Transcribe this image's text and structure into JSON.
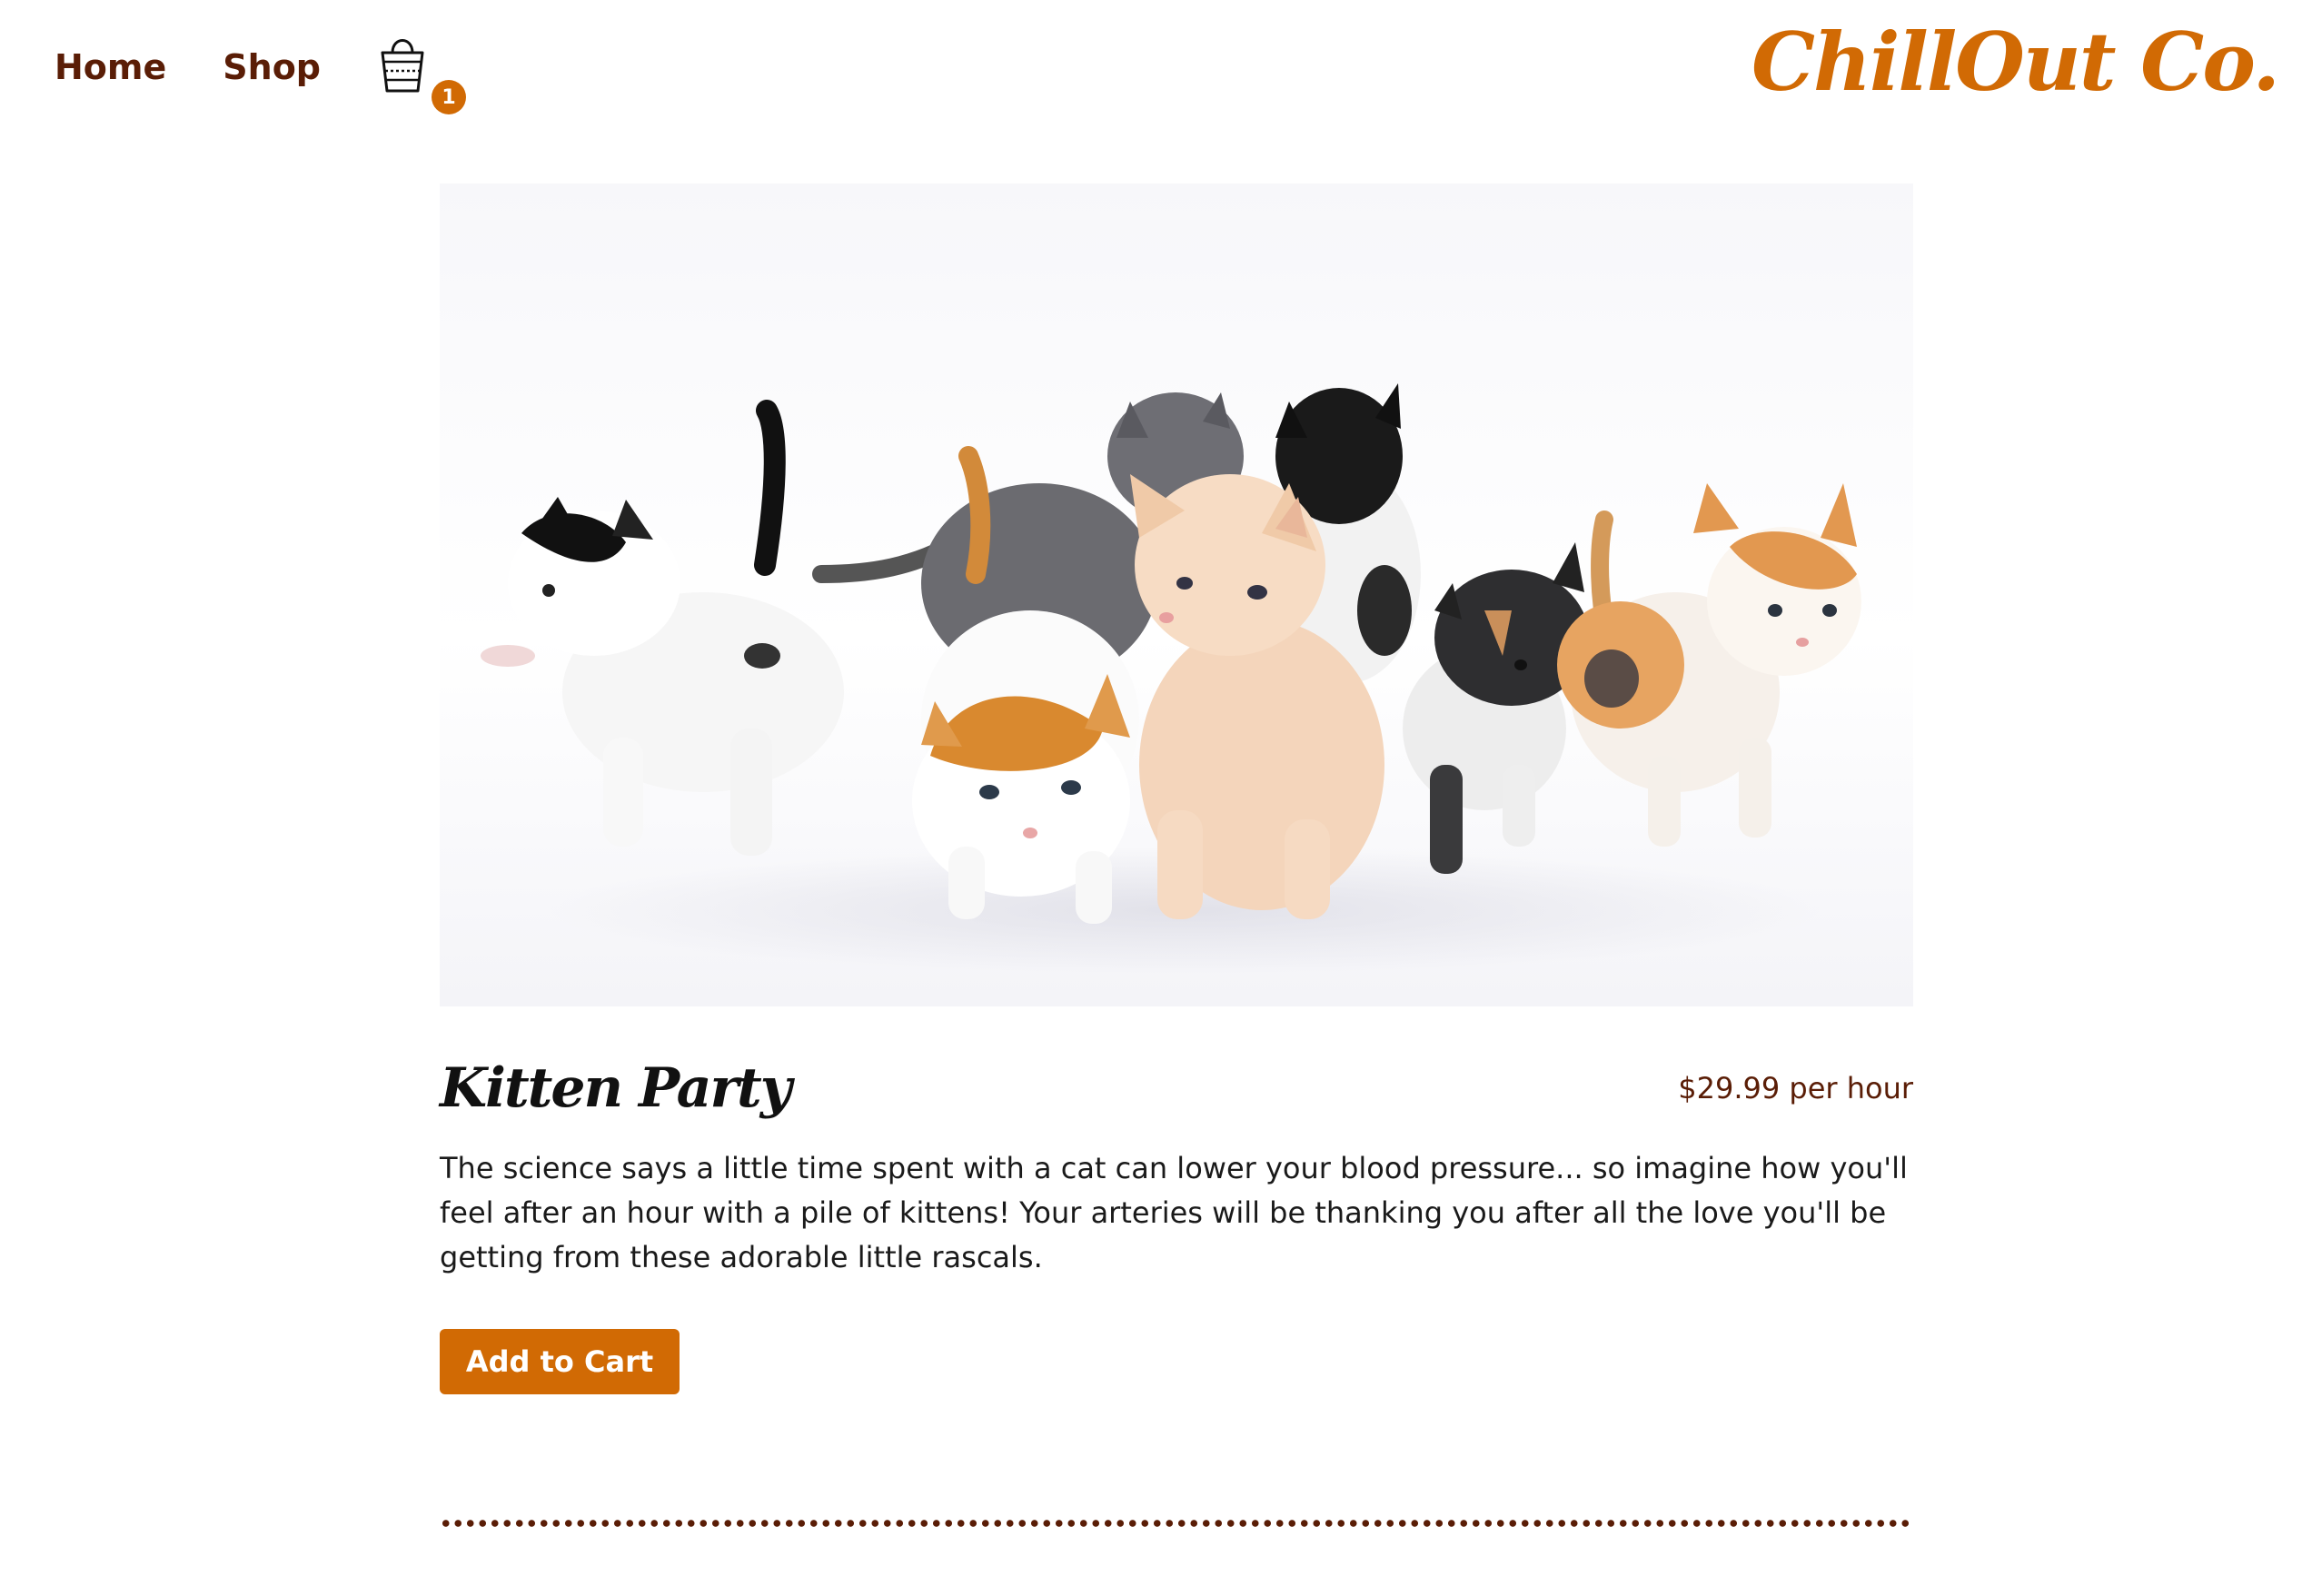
{
  "nav": {
    "home_label": "Home",
    "shop_label": "Shop",
    "cart_icon": "shopping-basket-icon",
    "cart_count": "1"
  },
  "brand": {
    "name": "ChillOut Co."
  },
  "product": {
    "image_subject": "kittens",
    "title": "Kitten Party",
    "price": "$29.99 per hour",
    "description": "The science says a little time spent with a cat can lower your blood pressure... so imagine how you'll feel after an hour with a pile of kittens! Your arteries will be thanking you after all the love you'll be getting from these adorable little rascals.",
    "add_to_cart_label": "Add to Cart"
  },
  "colors": {
    "accent": "#d16a04",
    "nav_text": "#5a1d06",
    "divider": "#5a1d06"
  }
}
